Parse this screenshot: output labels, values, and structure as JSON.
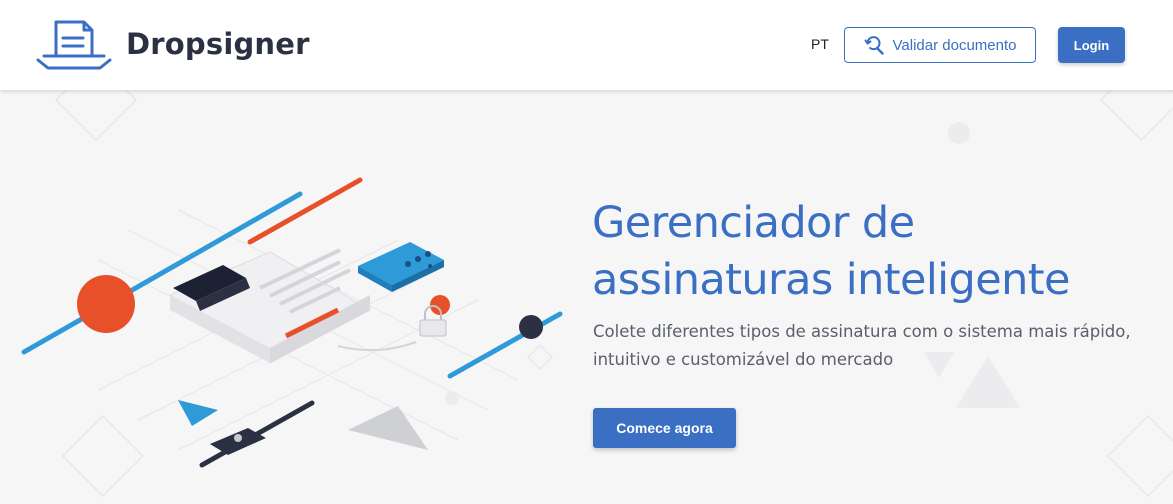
{
  "header": {
    "brand": "Dropsigner",
    "language": "PT",
    "validate_label": "Validar documento",
    "login_label": "Login"
  },
  "hero": {
    "title_line1": "Gerenciador de",
    "title_line2": "assinaturas inteligente",
    "subtitle_line1": "Colete diferentes tipos de assinatura com o sistema mais rápido,",
    "subtitle_line2": "intuitivo e customizável do mercado",
    "cta_label": "Comece agora"
  },
  "icons": {
    "logo": "document-tray-icon",
    "validate": "magnifier-refresh-icon",
    "lock": "padlock-icon"
  },
  "colors": {
    "primary": "#3a6fc3",
    "accent_blue": "#2e9ad8",
    "accent_orange": "#e8502a",
    "navy": "#2b3142",
    "background": "#f6f6f7"
  }
}
